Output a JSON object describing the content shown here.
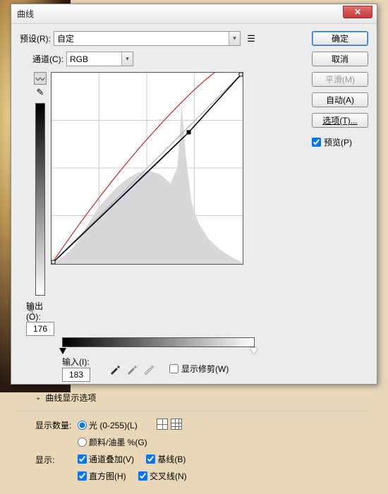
{
  "title": "曲线",
  "preset": {
    "label": "预设(R):",
    "value": "自定"
  },
  "channel": {
    "label": "通道(C):",
    "value": "RGB"
  },
  "buttons": {
    "ok": "确定",
    "cancel": "取消",
    "smooth": "平滑(M)",
    "auto": "自动(A)",
    "options": "选项(T)..."
  },
  "preview": {
    "label": "预览(P)",
    "checked": true
  },
  "output": {
    "label": "输出(O):",
    "value": "176"
  },
  "input": {
    "label": "输入(I):",
    "value": "183"
  },
  "showClipping": {
    "label": "显示修剪(W)",
    "checked": false
  },
  "displayOptions": "曲线显示选项",
  "displayAmount": {
    "label": "显示数量:",
    "light": "光 (0-255)(L)",
    "pigment": "颜料/油墨 %(G)",
    "selected": "light"
  },
  "show": {
    "label": "显示:",
    "overlay": "通道叠加(V)",
    "histogram": "直方图(H)",
    "baseline": "基线(B)",
    "intersection": "交叉线(N)"
  },
  "chart_data": {
    "type": "curve",
    "xlabel": "输入",
    "ylabel": "输出",
    "xlim": [
      0,
      255
    ],
    "ylim": [
      0,
      255
    ],
    "series": [
      {
        "name": "baseline",
        "color": "#888",
        "points": [
          [
            0,
            0
          ],
          [
            255,
            255
          ]
        ]
      },
      {
        "name": "red-channel",
        "color": "#d03030",
        "points": [
          [
            0,
            0
          ],
          [
            90,
            120
          ],
          [
            180,
            215
          ],
          [
            255,
            255
          ]
        ]
      },
      {
        "name": "blue-channel",
        "color": "#3040c0",
        "points": [
          [
            0,
            0
          ],
          [
            183,
            176
          ],
          [
            255,
            255
          ]
        ]
      },
      {
        "name": "rgb-active",
        "color": "#000",
        "points": [
          [
            0,
            0
          ],
          [
            183,
            176
          ],
          [
            255,
            255
          ]
        ],
        "control_point": [
          183,
          176
        ]
      }
    ]
  }
}
